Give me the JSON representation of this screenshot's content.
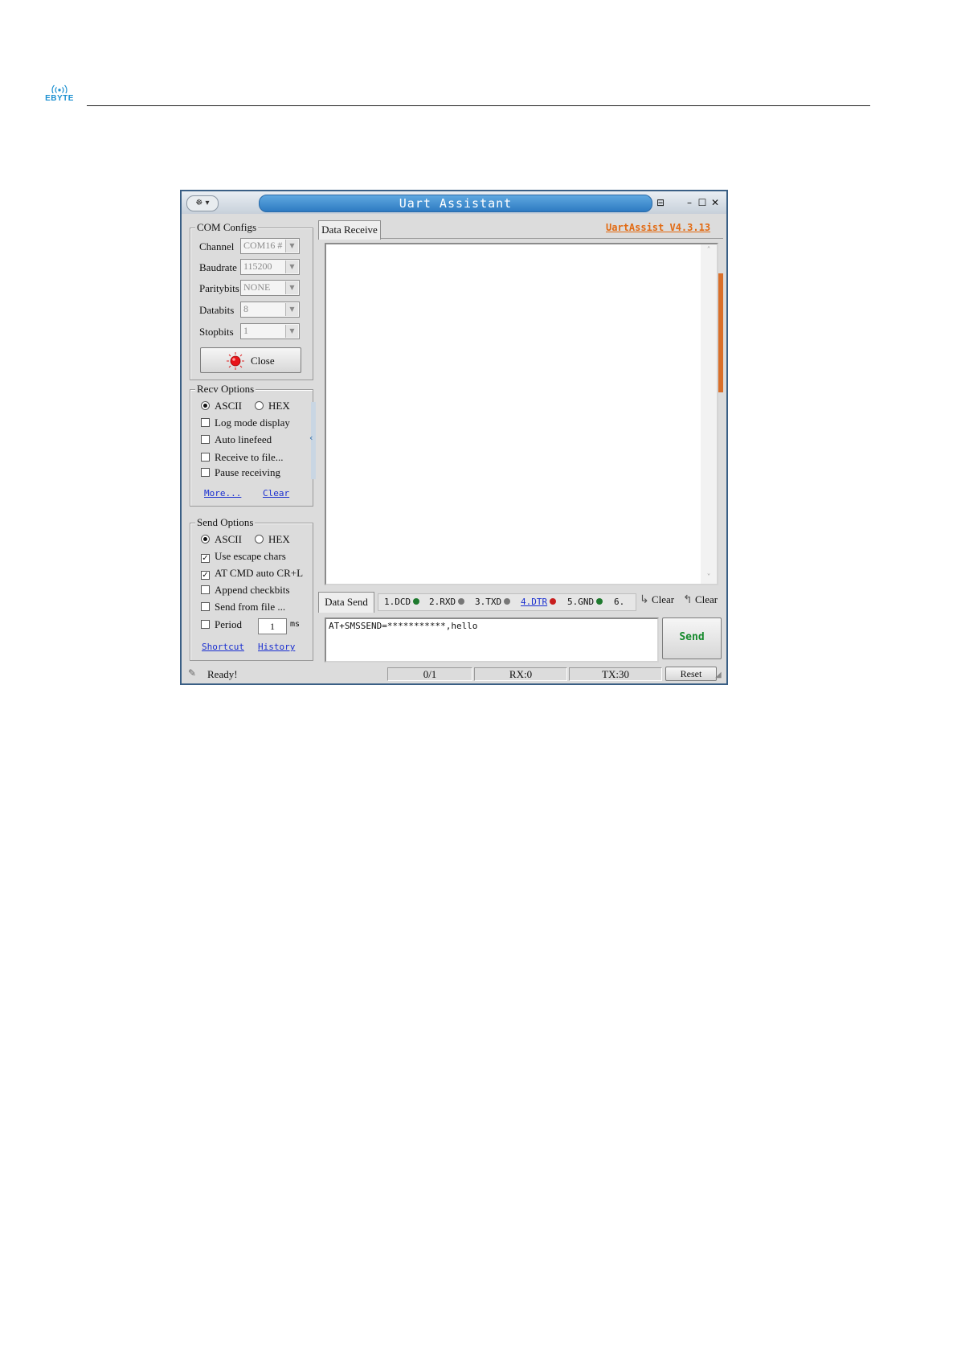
{
  "document": {
    "logo_text": "EBYTE"
  },
  "window": {
    "title": "Uart Assistant",
    "sys_menu_glyph": "☸ ▾",
    "buttons": {
      "pin": "⊟",
      "minimize": "–",
      "maximize": "☐",
      "close": "✕"
    },
    "version": "UartAssist V4.3.13"
  },
  "com_configs": {
    "title": "COM Configs",
    "fields": [
      {
        "label": "Channel",
        "value": "COM16 #"
      },
      {
        "label": "Baudrate",
        "value": "115200"
      },
      {
        "label": "Paritybits",
        "value": "NONE"
      },
      {
        "label": "Databits",
        "value": "8"
      },
      {
        "label": "Stopbits",
        "value": "1"
      }
    ],
    "close_button": "Close"
  },
  "recv_options": {
    "title": "Recv Options",
    "ascii": "ASCII",
    "hex": "HEX",
    "options": [
      "Log mode display",
      "Auto linefeed",
      "Receive to file...",
      "Pause receiving"
    ],
    "more_link": "More...",
    "clear_link": "Clear"
  },
  "send_options": {
    "title": "Send Options",
    "ascii": "ASCII",
    "hex": "HEX",
    "options": [
      {
        "label": "Use escape chars",
        "checked": true
      },
      {
        "label": "AT CMD auto CR+L",
        "checked": true
      },
      {
        "label": "Append checkbits",
        "checked": false
      },
      {
        "label": "Send from file ...",
        "checked": false
      }
    ],
    "period_label": "Period",
    "period_value": "1",
    "period_unit": "ms",
    "shortcut_link": "Shortcut",
    "history_link": "History"
  },
  "data_receive": {
    "tab_label": "Data Receive"
  },
  "data_send": {
    "tab_label": "Data Send",
    "pins": [
      {
        "label": "1.DCD",
        "color": "#1e7a2e"
      },
      {
        "label": "2.RXD",
        "color": "#777777"
      },
      {
        "label": "3.TXD",
        "color": "#777777"
      },
      {
        "label": "4.DTR",
        "color": "#c81e1e"
      },
      {
        "label": "5.GND",
        "color": "#1e7a2e"
      },
      {
        "label": "6.",
        "color": ""
      }
    ],
    "clear_recv": "Clear",
    "clear_send": "Clear",
    "input_text": "AT+SMSSEND=***********,hello",
    "send_button": "Send"
  },
  "status_bar": {
    "ready": "Ready!",
    "count": "0/1",
    "rx": "RX:0",
    "tx": "TX:30",
    "reset_button": "Reset"
  }
}
